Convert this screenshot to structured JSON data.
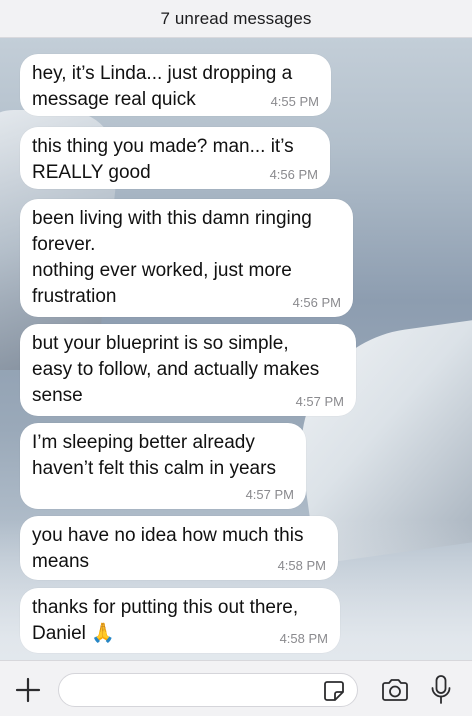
{
  "header": {
    "title": "7 unread messages"
  },
  "messages": [
    {
      "text": "hey, it’s Linda... just dropping a\nmessage real quick",
      "time": "4:55 PM"
    },
    {
      "text": "this thing you made? man... it’s\nREALLY good",
      "time": "4:56 PM"
    },
    {
      "text": "been living with this damn ringing\nforever.\nnothing ever worked, just more\nfrustration",
      "time": "4:56 PM"
    },
    {
      "text": "but your blueprint is so simple,\neasy to follow, and actually makes\nsense",
      "time": "4:57 PM"
    },
    {
      "text": "I’m sleeping better already\nhaven’t felt this calm in years",
      "time": "4:57 PM"
    },
    {
      "text": "you have no idea how much this\nmeans",
      "time": "4:58 PM"
    },
    {
      "text": "thanks for putting this out there,\nDaniel 🙏",
      "time": "4:58 PM"
    }
  ],
  "composer": {
    "input_value": "",
    "input_placeholder": ""
  },
  "icons": {
    "attach": "plus-icon",
    "sticker": "sticker-icon",
    "camera": "camera-icon",
    "mic": "microphone-icon"
  },
  "colors": {
    "bubble": "#ffffff",
    "header_bg": "#f2f2f4",
    "accent": "#1c1c1e",
    "time": "#8a8a8e"
  }
}
